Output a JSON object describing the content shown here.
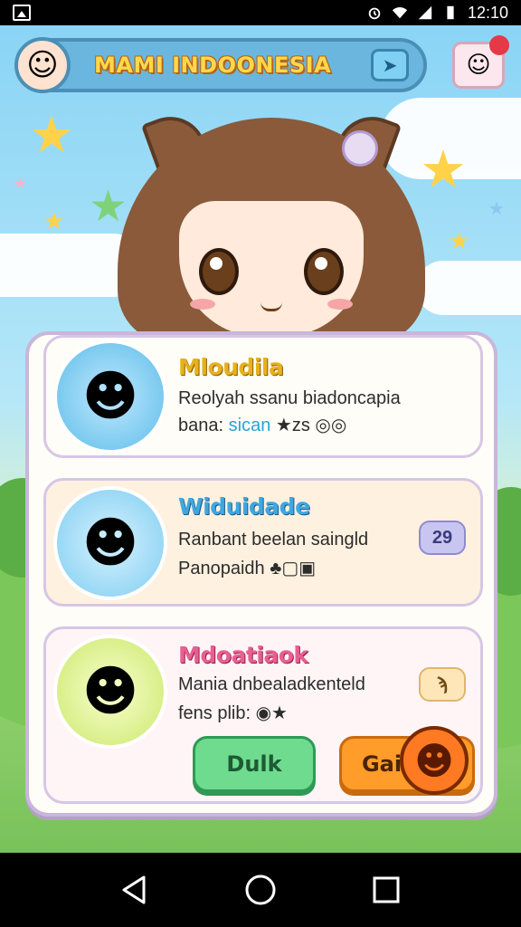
{
  "status_bar": {
    "time": "12:10"
  },
  "header": {
    "title": "MAMI INDOONESIA",
    "share_icon": "share-icon",
    "profile_icon": "face-icon"
  },
  "colors": {
    "header_bg": "#6bb6de",
    "title": "#ffd84a",
    "btn_green": "#6fdb8e",
    "btn_orange": "#ff9c2a"
  },
  "cards": [
    {
      "name": "Mloudila",
      "line1": "Reolyah ssanu biadoncapia",
      "line2_prefix": "bana:",
      "line2_accent": "sican",
      "line2_suffix": "★zs ◎◎"
    },
    {
      "name": "Widuidade",
      "line1": "Ranbant beelan saingld",
      "line2": "Panopaidh ♣▢▣",
      "badge": "29"
    },
    {
      "name": "Mdoatiaok",
      "line1": "Mania dnbealadkenteld",
      "line2": "fens plib: ◉★",
      "badge": "ϡ"
    }
  ],
  "buttons": {
    "primary": "Dulk",
    "secondary": "Gaik"
  }
}
